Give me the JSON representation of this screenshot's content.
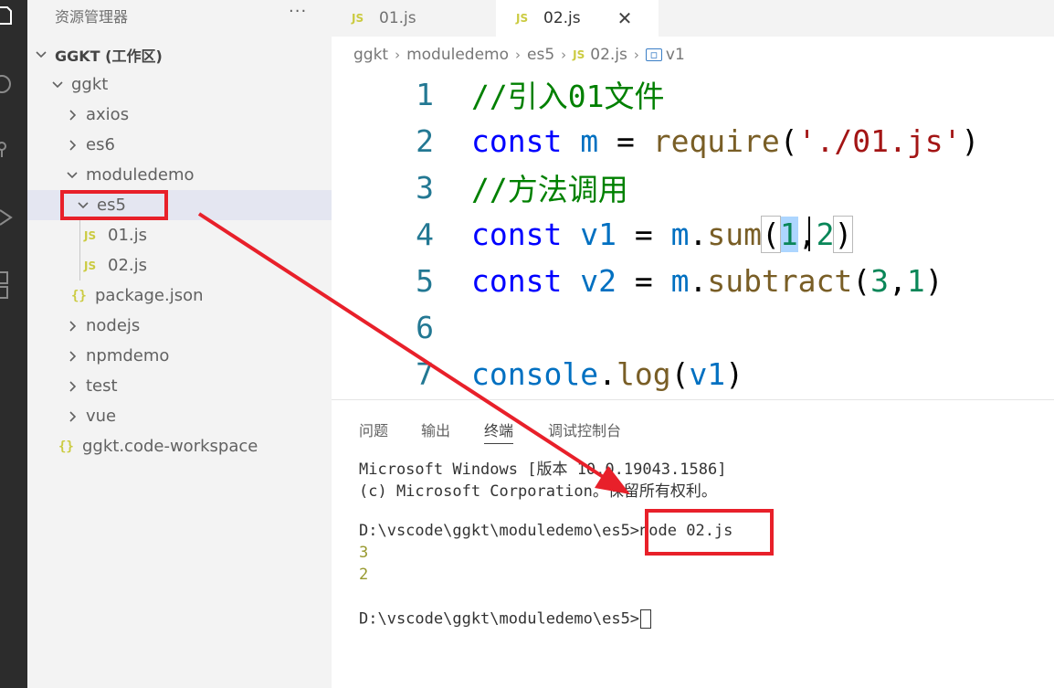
{
  "sidebar": {
    "title": "资源管理器",
    "more": "···",
    "workspace": "GGKT (工作区)",
    "items": [
      {
        "label": "ggkt"
      },
      {
        "label": "axios"
      },
      {
        "label": "es6"
      },
      {
        "label": "moduledemo"
      },
      {
        "label": "es5"
      },
      {
        "label": "01.js",
        "badge": "JS"
      },
      {
        "label": "02.js",
        "badge": "JS"
      },
      {
        "label": "package.json",
        "badge": "{}"
      },
      {
        "label": "nodejs"
      },
      {
        "label": "npmdemo"
      },
      {
        "label": "test"
      },
      {
        "label": "vue"
      },
      {
        "label": "ggkt.code-workspace",
        "badge": "{}"
      }
    ]
  },
  "tabs": [
    {
      "label": "01.js",
      "badge": "JS"
    },
    {
      "label": "02.js",
      "badge": "JS",
      "close": "✕"
    }
  ],
  "breadcrumb": [
    "ggkt",
    "moduledemo",
    "es5",
    "02.js",
    "v1"
  ],
  "breadcrumb_badge": "JS",
  "editor": {
    "line_numbers": [
      "1",
      "2",
      "3",
      "4",
      "5",
      "6",
      "7"
    ],
    "line1": "//引入01文件",
    "line2": {
      "kw": "const",
      "var": "m",
      "op": " = ",
      "fn": "require",
      "open": "(",
      "str": "'./01.js'",
      "close": ")"
    },
    "line3": "//方法调用",
    "line4": {
      "kw": "const",
      "var": "v1",
      "op": " = ",
      "obj": "m",
      "dot": ".",
      "fn": "sum",
      "open": "(",
      "a": "1",
      "comma": ",",
      "b": "2",
      "close": ")"
    },
    "line5": {
      "kw": "const",
      "var": "v2",
      "op": " = ",
      "obj": "m",
      "dot": ".",
      "fn": "subtract",
      "open": "(",
      "a": "3",
      "comma": ",",
      "b": "1",
      "close": ")"
    },
    "line7": {
      "obj": "console",
      "dot": ".",
      "fn": "log",
      "open": "(",
      "arg": "v1",
      "close": ")"
    }
  },
  "panel": {
    "tabs": [
      "问题",
      "输出",
      "终端",
      "调试控制台"
    ],
    "active_tab": "终端",
    "terminal": [
      "Microsoft Windows [版本 10.0.19043.1586]",
      "(c) Microsoft Corporation。保留所有权利。",
      "D:\\vscode\\ggkt\\moduledemo\\es5>",
      "node 02.js",
      "3",
      "2",
      "D:\\vscode\\ggkt\\moduledemo\\es5>"
    ]
  },
  "colors": {
    "annotation_red": "#e8202a",
    "keyword": "#0000ff",
    "comment": "#008000",
    "function": "#795e26",
    "string": "#a31515",
    "number": "#098658",
    "variable": "#0070c1"
  }
}
